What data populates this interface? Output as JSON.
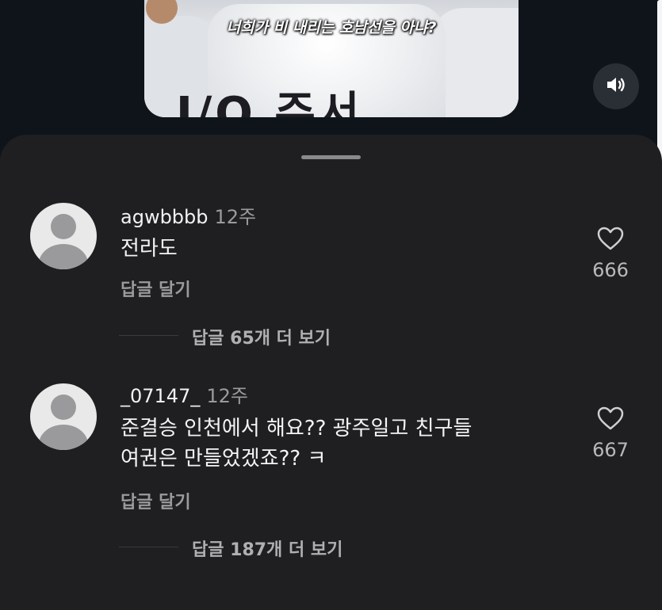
{
  "video": {
    "subtitle": "너희가 비 내리는 호남선을 아냐?",
    "jersey_text": "I/O 주서"
  },
  "comments": [
    {
      "username": "agwbbbb",
      "time": "12주",
      "lines": [
        "전라도"
      ],
      "reply_label": "답글 달기",
      "likes": "666",
      "view_replies": "답글 65개 더 보기"
    },
    {
      "username": "_07147_",
      "time": "12주",
      "lines": [
        "준결승 인천에서 해요?? 광주일고 친구들",
        "여권은 만들었겠죠?? ㅋ"
      ],
      "reply_label": "답글 달기",
      "likes": "667",
      "view_replies": "답글 187개 더 보기"
    }
  ]
}
